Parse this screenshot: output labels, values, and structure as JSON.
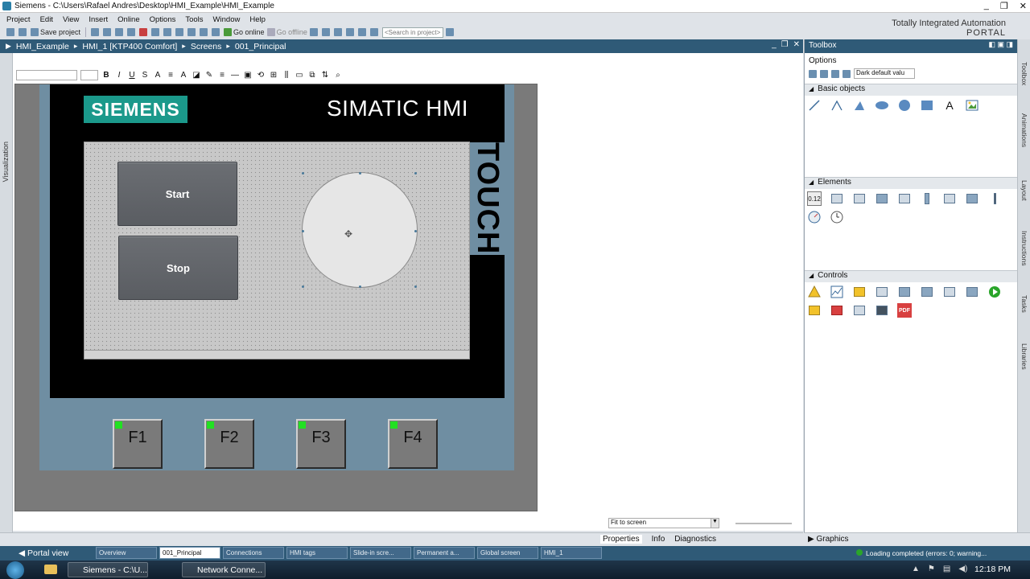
{
  "window": {
    "title": "Siemens - C:\\Users\\Rafael Andres\\Desktop\\HMI_Example\\HMI_Example",
    "controls": [
      "_",
      "❐",
      "✕"
    ]
  },
  "brand": {
    "line1": "Totally Integrated Automation",
    "line2": "PORTAL"
  },
  "menu": [
    "Project",
    "Edit",
    "View",
    "Insert",
    "Online",
    "Options",
    "Tools",
    "Window",
    "Help"
  ],
  "toolbar": {
    "save_label": "Save project",
    "go_online_label": "Go online",
    "go_offline_label": "Go offline",
    "search_placeholder": "<Search in project>"
  },
  "breadcrumb": [
    "HMI_Example",
    "HMI_1 [KTP400 Comfort]",
    "Screens",
    "001_Principal"
  ],
  "left_strip_label": "Visualization",
  "device": {
    "logo": "SIEMENS",
    "model_text": "SIMATIC HMI",
    "touch_text": "TOUCH",
    "buttons": {
      "start": "Start",
      "stop": "Stop"
    },
    "fkeys": [
      "F1",
      "F2",
      "F3",
      "F4"
    ],
    "move_cursor": "✥"
  },
  "zoom": {
    "value": "Fit to screen"
  },
  "properties_tabs": [
    "Properties",
    "Info",
    "Diagnostics"
  ],
  "toolbox": {
    "title": "Toolbox",
    "options_label": "Options",
    "style_value": "Dark default valu",
    "sections": {
      "basic": "Basic objects",
      "elements": "Elements",
      "controls": "Controls"
    },
    "basic_text_tool": "A",
    "elements_numeric": "0.12",
    "controls_pdf": "PDF"
  },
  "right_strip": [
    "Toolbox",
    "Animations",
    "Layout",
    "Instructions",
    "Tasks",
    "Libraries"
  ],
  "graphics_label": "Graphics",
  "portal": {
    "view_label": "Portal view",
    "tabs": [
      "Overview",
      "001_Principal",
      "Connections",
      "HMI tags",
      "Slide-in scre...",
      "Permanent a...",
      "Global screen",
      "HMI_1"
    ],
    "status": "Loading completed (errors: 0; warning..."
  },
  "taskbar": {
    "items": [
      "Siemens - C:\\U...",
      "Network Conne..."
    ],
    "clock": "12:18 PM"
  },
  "colors": {
    "accent_blue": "#2f5a77",
    "siemens_teal": "#1b998b",
    "device_body": "#6f8ea2",
    "fkey_led": "#22e022"
  }
}
